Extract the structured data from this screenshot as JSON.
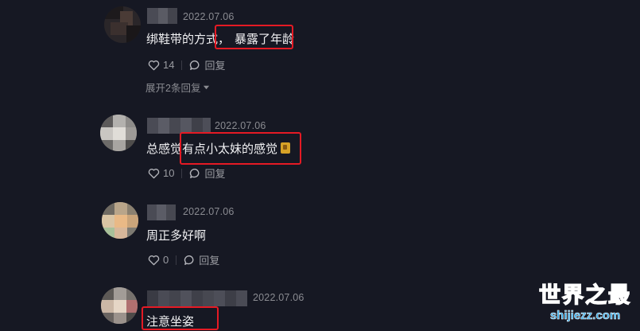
{
  "comments": [
    {
      "date": "2022.07.06",
      "text_before": "绑鞋带的方式，",
      "text_highlight": "暴露了年龄",
      "text_after": "",
      "likes": "14",
      "reply_label": "回复",
      "expand_label": "展开2条回复"
    },
    {
      "date": "2022.07.06",
      "text_before": "总感觉",
      "text_highlight": "有点小太妹的感觉",
      "text_after": "",
      "likes": "10",
      "reply_label": "回复"
    },
    {
      "date": "2022.07.06",
      "text_before": "周正多好啊",
      "text_highlight": "",
      "text_after": "",
      "likes": "0",
      "reply_label": "回复"
    },
    {
      "date": "2022.07.06",
      "text_before": "",
      "text_highlight": "注意坐姿",
      "text_after": "",
      "likes": "",
      "reply_label": ""
    }
  ],
  "watermark": {
    "title": "世界之最",
    "url": "shijiezz.com"
  },
  "colors": {
    "background": "#161823",
    "highlight_box": "#e51a24",
    "watermark": "#27a6e8"
  }
}
